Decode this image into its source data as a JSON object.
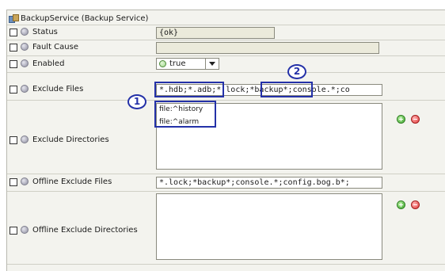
{
  "window_title": "BackupService  (Backup Service)",
  "properties": [
    {
      "label": "Status",
      "value": "{ok}"
    },
    {
      "label": "Fault Cause",
      "value": ""
    },
    {
      "label": "Enabled",
      "value": "true"
    },
    {
      "label": "Exclude Files",
      "value": "*.hdb;*.adb;*.lock;*backup*;console.*;co"
    },
    {
      "label": "Exclude Directories",
      "lines": [
        "file:^history",
        "file:^alarm"
      ]
    },
    {
      "label": "Offline Exclude Files",
      "value": "*.lock;*backup*;console.*;config.bog.b*;"
    },
    {
      "label": "Offline Exclude Directories",
      "lines": []
    }
  ],
  "callouts": [
    "1",
    "2"
  ],
  "icons": {
    "title": "backup-service-icon",
    "property": "property-dot-icon",
    "enabled": "true-status-icon",
    "add": "add-icon",
    "remove": "remove-icon"
  },
  "colors": {
    "highlight": "#2431a8",
    "add": "#3aa42a",
    "remove": "#e23a3a",
    "readonly_field": "#ebeadb"
  }
}
